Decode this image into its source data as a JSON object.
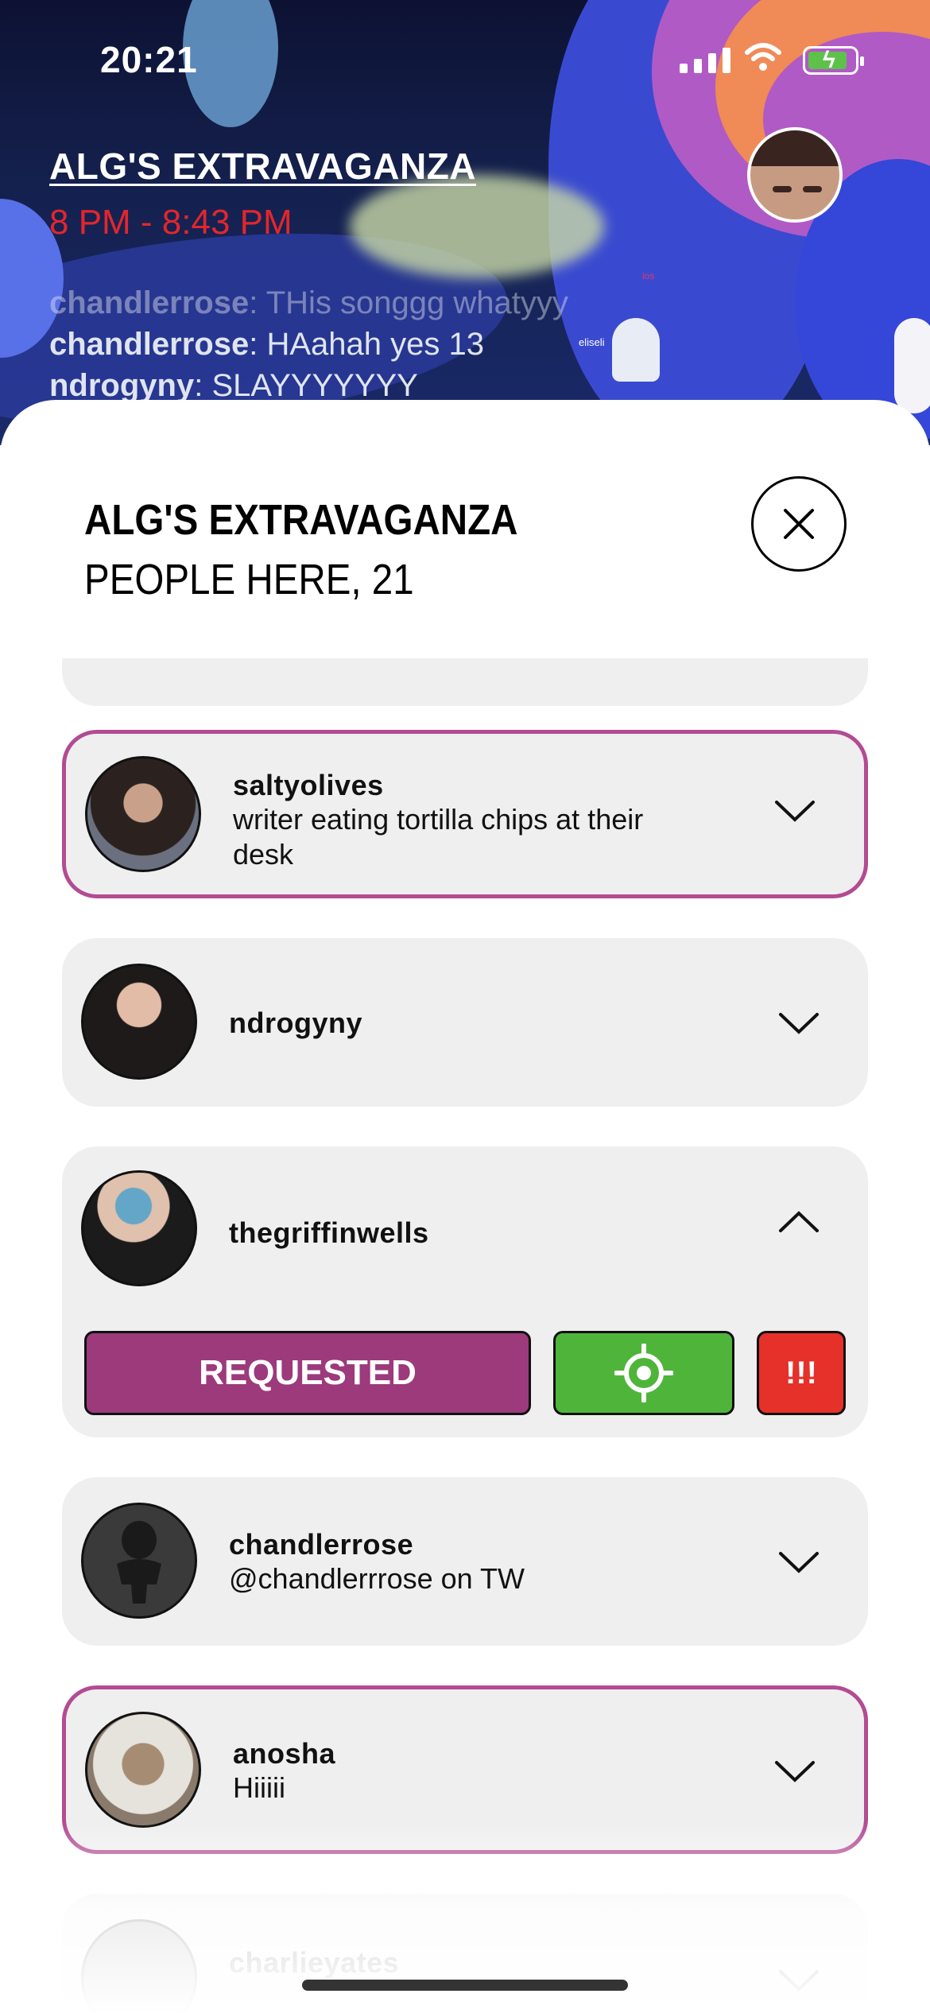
{
  "status_bar": {
    "time": "20:21"
  },
  "room": {
    "title": "ALG'S EXTRAVAGANZA",
    "time_range": "8 PM - 8:43 PM"
  },
  "chat": [
    {
      "user": "chandlerrose",
      "text": "THis songgg whatyyy"
    },
    {
      "user": "chandlerrose",
      "text": "HAahah yes 13"
    },
    {
      "user": "ndrogyny",
      "text": "SLAYYYYYYY"
    }
  ],
  "scene_labels": {
    "tag1": "ios",
    "tag2": "eliseli"
  },
  "sheet": {
    "title": "ALG'S EXTRAVAGANZA",
    "subtitle": "PEOPLE HERE, 21"
  },
  "people": [
    {
      "username": "saltyolives",
      "bio": "writer eating tortilla chips at their desk",
      "highlighted": true,
      "expanded": false
    },
    {
      "username": "ndrogyny",
      "bio": "",
      "highlighted": false,
      "expanded": false
    },
    {
      "username": "thegriffinwells",
      "bio": "",
      "highlighted": false,
      "expanded": true
    },
    {
      "username": "chandlerrose",
      "bio": "@chandlerrrose on TW",
      "highlighted": false,
      "expanded": false
    },
    {
      "username": "anosha",
      "bio": "Hiiiii",
      "highlighted": true,
      "expanded": false
    },
    {
      "username": "charlieyates",
      "bio": "",
      "highlighted": false,
      "expanded": false
    }
  ],
  "actions": {
    "requested_label": "REQUESTED",
    "report_label": "!!!"
  },
  "colors": {
    "accent_pink": "#b34b93",
    "requested": "#9c3a7c",
    "locate": "#4fb53a",
    "report": "#e6302a",
    "time_red": "#e3262c"
  }
}
